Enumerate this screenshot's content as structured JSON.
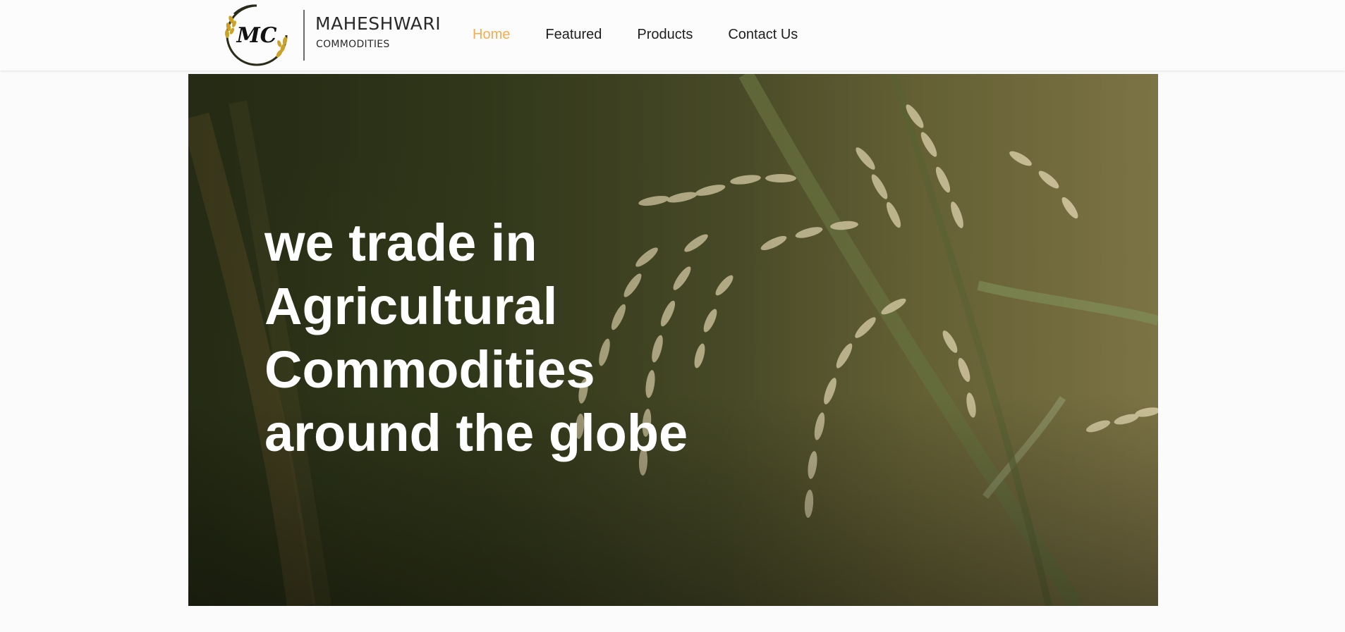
{
  "brand": {
    "logo_initials": "MC",
    "name": "MAHESHWARI",
    "subtitle": "COMMODITIES"
  },
  "nav": {
    "items": [
      {
        "label": "Home",
        "active": true
      },
      {
        "label": "Featured",
        "active": false
      },
      {
        "label": "Products",
        "active": false
      },
      {
        "label": "Contact Us",
        "active": false
      }
    ]
  },
  "hero": {
    "heading": "we trade in Agricultural Commodities around the globe",
    "image": "rice-paddy-grain-photo"
  },
  "colors": {
    "accent": "#f2ae52",
    "nav_text": "#1e1e1e",
    "header_bg": "#fcfcfc",
    "hero_text": "#ffffff"
  }
}
